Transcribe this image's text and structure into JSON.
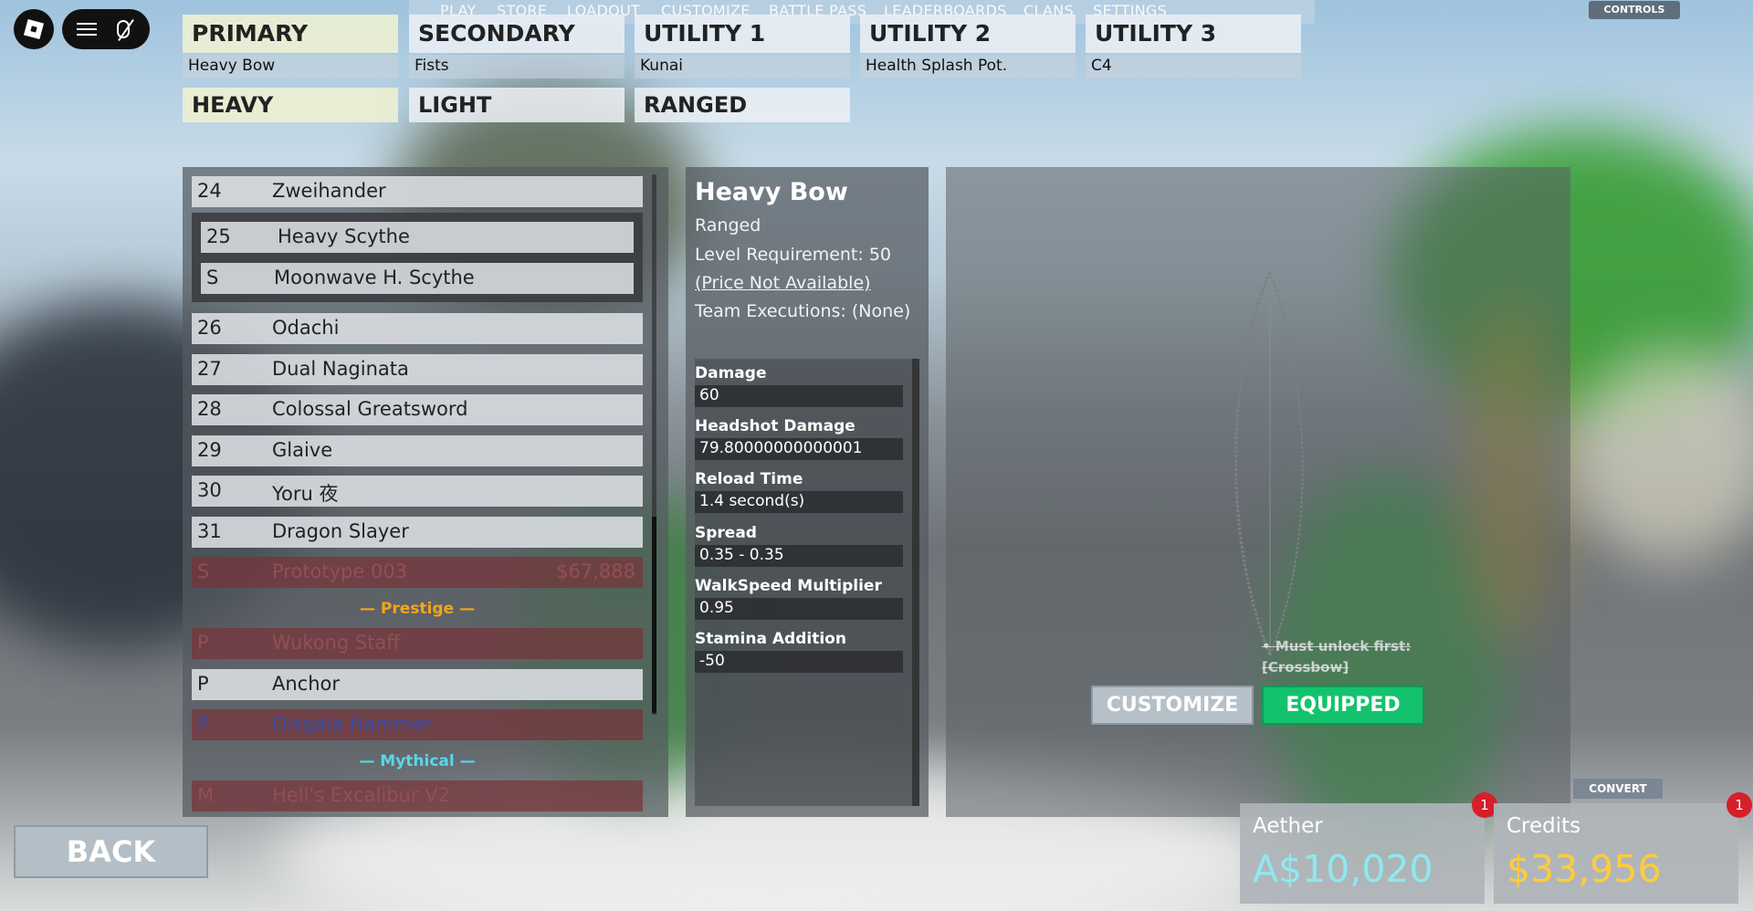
{
  "topnav": [
    "PLAY",
    "STORE",
    "LOADOUT",
    "CUSTOMIZE",
    "BATTLE PASS",
    "LEADERBOARDS",
    "CLANS",
    "SETTINGS"
  ],
  "controls_label": "CONTROLS",
  "slots": [
    {
      "label": "PRIMARY",
      "value": "Heavy Bow"
    },
    {
      "label": "SECONDARY",
      "value": "Fists"
    },
    {
      "label": "UTILITY 1",
      "value": "Kunai"
    },
    {
      "label": "UTILITY 2",
      "value": "Health Splash Pot."
    },
    {
      "label": "UTILITY 3",
      "value": "C4"
    }
  ],
  "categories": [
    "HEAVY",
    "LIGHT",
    "RANGED"
  ],
  "list": {
    "items": [
      {
        "num": "24",
        "name": "Zweihander"
      },
      {
        "num": "25",
        "name": "Heavy Scythe"
      },
      {
        "num": "S",
        "name": "Moonwave H. Scythe"
      },
      {
        "num": "26",
        "name": "Odachi"
      },
      {
        "num": "27",
        "name": "Dual Naginata"
      },
      {
        "num": "28",
        "name": "Colossal Greatsword"
      },
      {
        "num": "29",
        "name": "Glaive"
      },
      {
        "num": "30",
        "name": "Yoru 夜"
      },
      {
        "num": "31",
        "name": "Dragon Slayer"
      },
      {
        "num": "S",
        "name": "Prototype 003",
        "price": "$67,888"
      },
      {
        "num": "P",
        "name": "Wukong Staff"
      },
      {
        "num": "P",
        "name": "Anchor"
      },
      {
        "num": "P",
        "name": "Disgaia Hammer"
      },
      {
        "num": "M",
        "name": "Hell's Excalibur V2"
      }
    ],
    "sep_prestige": "— Prestige —",
    "sep_mythical": "— Mythical —"
  },
  "info": {
    "title": "Heavy Bow",
    "type": "Ranged",
    "level": "Level Requirement: 50",
    "price": "(Price Not Available)",
    "team": "Team Executions: (None)",
    "stats": [
      {
        "label": "Damage",
        "value": "60"
      },
      {
        "label": "Headshot Damage",
        "value": "79.80000000000001"
      },
      {
        "label": "Reload Time",
        "value": "1.4 second(s)"
      },
      {
        "label": "Spread",
        "value": "0.35 - 0.35"
      },
      {
        "label": "WalkSpeed Multiplier",
        "value": "0.95"
      },
      {
        "label": "Stamina Addition",
        "value": "-50"
      }
    ]
  },
  "preview": {
    "unlock_line1": "• Must unlock first:",
    "unlock_line2": "[Crossbow]",
    "customize_label": "CUSTOMIZE",
    "equipped_label": "EQUIPPED"
  },
  "back_label": "BACK",
  "convert_label": "CONVERT",
  "currency": {
    "aether_label": "Aether",
    "aether_amount": "A$10,020",
    "aether_badge": "1",
    "credits_label": "Credits",
    "credits_amount": "$33,956",
    "credits_badge": "1"
  },
  "colors": {
    "aether": "#8fe8f0",
    "credits": "#ffcc3a",
    "prestige": "#f2a516",
    "mythical": "#58d8e8",
    "equipped": "#14c26d",
    "badge": "#d51f2a"
  }
}
